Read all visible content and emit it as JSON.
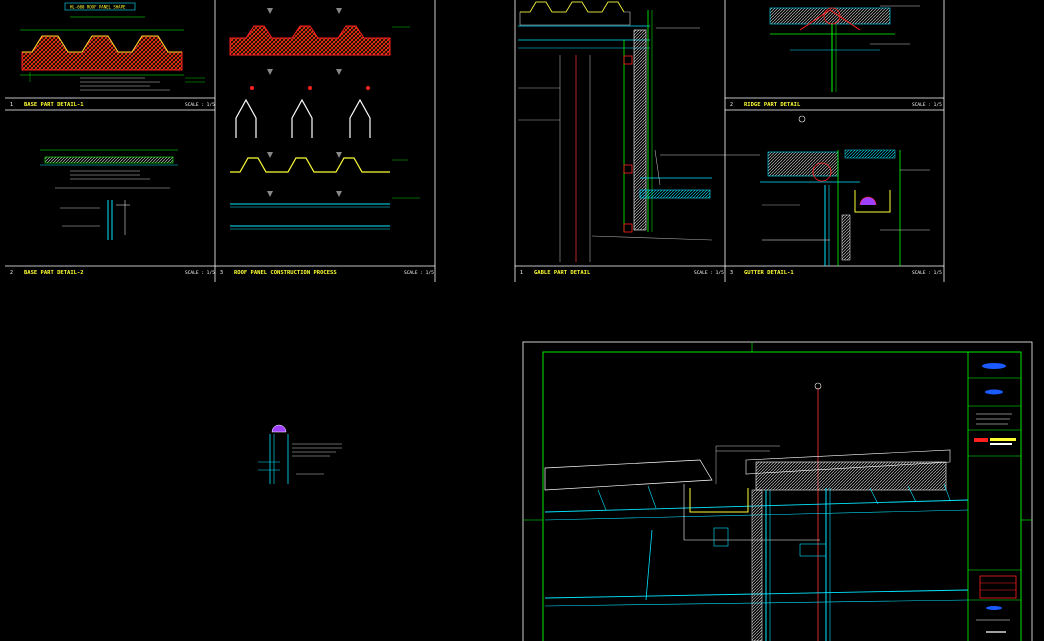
{
  "colors": {
    "background": "#000000",
    "frame": "#ffffff",
    "title_text": "#ffff33",
    "panel": "#ff2020",
    "dimension": "#00ff00",
    "structure": "#00e5ff",
    "centerline": "#ff3333",
    "arrow": "#888888"
  },
  "sheet_top": {
    "drawings": [
      {
        "num": "1",
        "title": "BASE PART DETAIL-1",
        "scale": "SCALE : 1/5"
      },
      {
        "num": "2",
        "title": "BASE PART DETAIL-2",
        "scale": "SCALE : 1/5"
      },
      {
        "num": "3",
        "title": "ROOF PANEL CONSTRUCTION PROCESS",
        "scale": "SCALE : 1/5"
      },
      {
        "num": "1",
        "title": "GABLE PART DETAIL",
        "scale": "SCALE : 1/5"
      },
      {
        "num": "2",
        "title": "RIDGE PART DETAIL",
        "scale": "SCALE : 1/5"
      },
      {
        "num": "3",
        "title": "GUTTER DETAIL-1",
        "scale": "SCALE : 1/5"
      }
    ],
    "panel_shape_tag": "HL-600 ROOF PANEL SHAPE"
  },
  "icons": [
    "process-arrow-icon",
    "section-marker-icon",
    "anchor-bolt-icon"
  ]
}
